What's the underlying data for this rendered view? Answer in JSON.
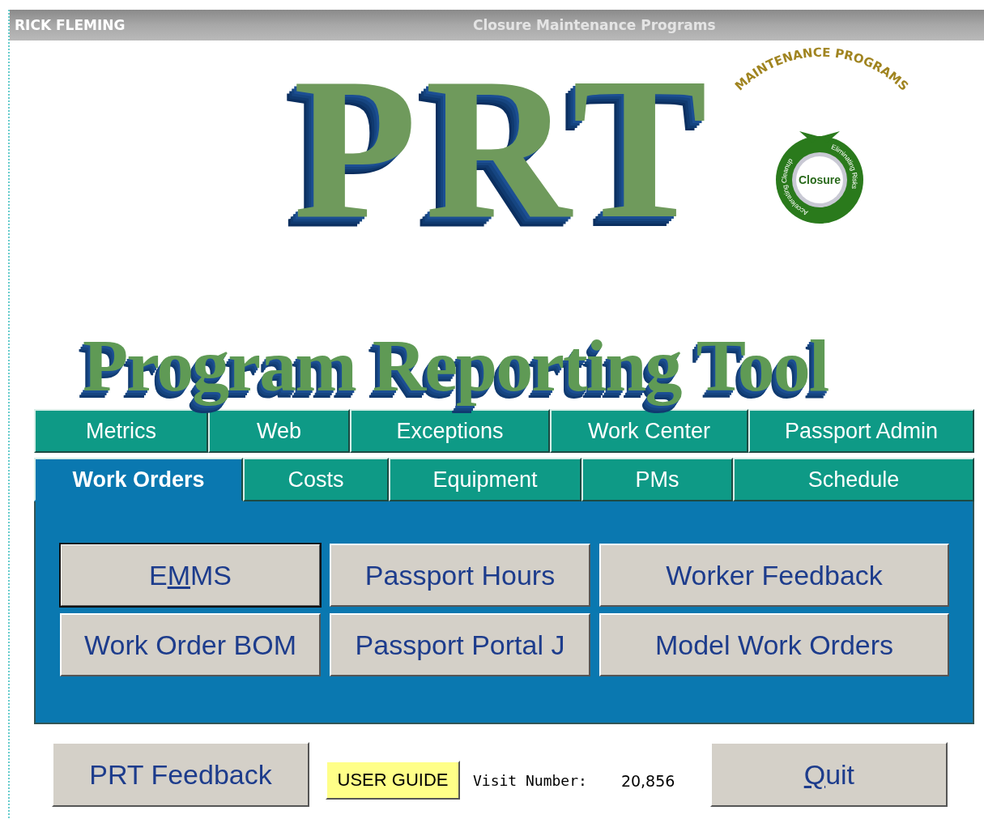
{
  "title_bar": {
    "user": "RICK FLEMING",
    "title": "Closure Maintenance Programs"
  },
  "logo": {
    "letters": "PRT",
    "name": "Program Reporting Tool"
  },
  "badge": {
    "arc_text": "MAINTENANCE PROGRAMS",
    "center": "Closure",
    "left_arrow": "Accelerating Cleanup",
    "right_arrow": "Eliminating Risks"
  },
  "tab_rows": [
    [
      {
        "label": "Metrics",
        "selected": false
      },
      {
        "label": "Web",
        "selected": false
      },
      {
        "label": "Exceptions",
        "selected": false
      },
      {
        "label": "Work Center",
        "selected": false
      },
      {
        "label": "Passport Admin",
        "selected": false
      }
    ],
    [
      {
        "label": "Work Orders",
        "selected": true
      },
      {
        "label": "Costs",
        "selected": false
      },
      {
        "label": "Equipment",
        "selected": false
      },
      {
        "label": "PMs",
        "selected": false
      },
      {
        "label": "Schedule",
        "selected": false
      }
    ]
  ],
  "buttons": [
    {
      "label_parts": [
        {
          "text": "E",
          "underlined": false
        },
        {
          "text": "M",
          "underlined": true
        },
        {
          "text": "MS",
          "underlined": false
        }
      ],
      "focused": true
    },
    {
      "label_parts": [
        {
          "text": "Passport Hours",
          "underlined": false
        }
      ],
      "focused": false
    },
    {
      "label_parts": [
        {
          "text": "Worker Feedback",
          "underlined": false
        }
      ],
      "focused": false
    },
    {
      "label_parts": [
        {
          "text": "Work Order BOM",
          "underlined": false
        }
      ],
      "focused": false
    },
    {
      "label_parts": [
        {
          "text": "Passport Portal J",
          "underlined": false
        }
      ],
      "focused": false
    },
    {
      "label_parts": [
        {
          "text": "Model Work Orders",
          "underlined": false
        }
      ],
      "focused": false
    }
  ],
  "footer": {
    "feedback_button": "PRT Feedback",
    "user_guide_button": "USER GUIDE",
    "visit_label": "Visit Number:",
    "visit_value": "20,856",
    "quit_button": [
      {
        "text": "Q",
        "underlined": true
      },
      {
        "text": "uit",
        "underlined": false
      }
    ]
  }
}
